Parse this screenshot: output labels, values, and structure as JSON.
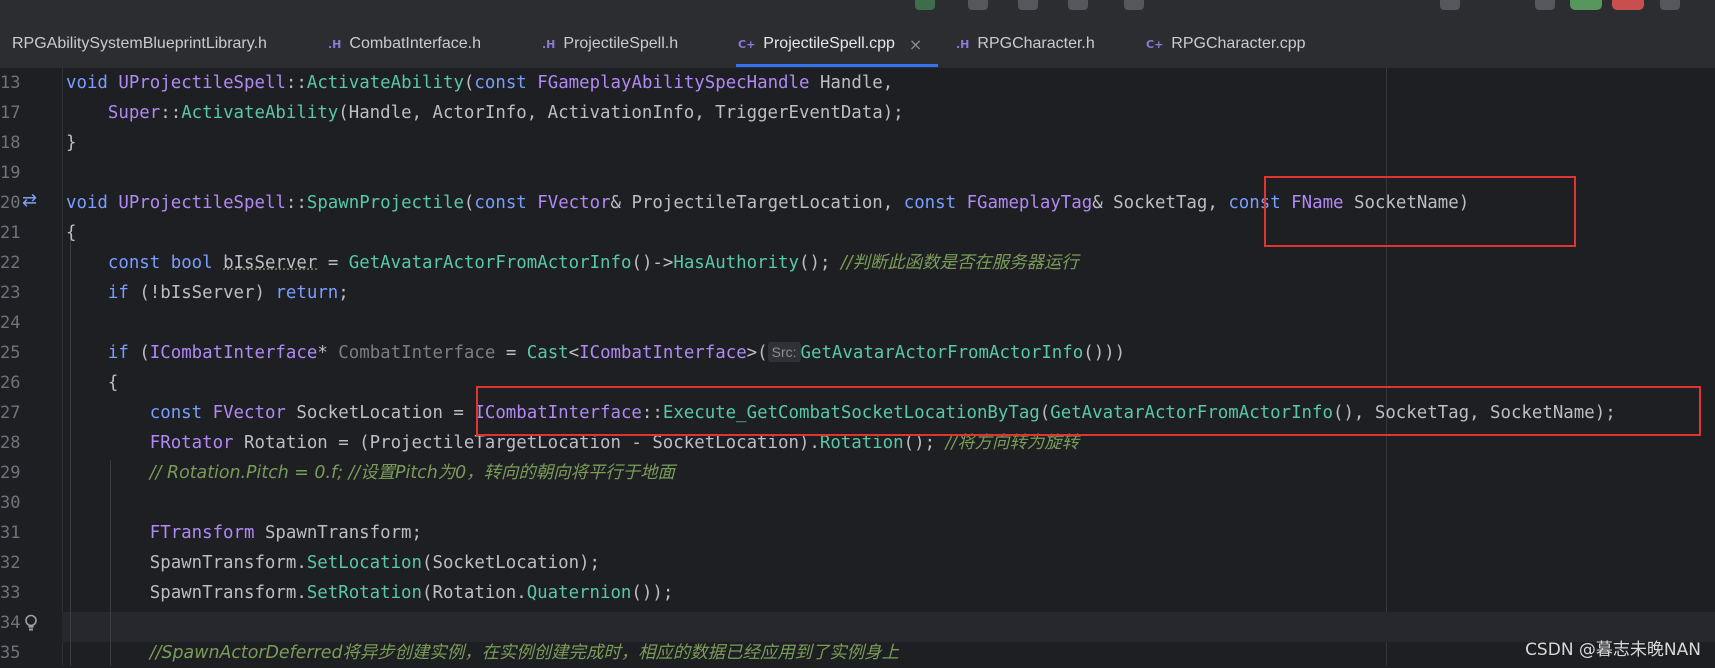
{
  "tabs": [
    {
      "label": "RPGAbilitySystemBlueprintLibrary.h",
      "ext": "",
      "active": false
    },
    {
      "label": "CombatInterface.h",
      "ext": ".H",
      "active": false
    },
    {
      "label": "ProjectileSpell.h",
      "ext": ".H",
      "active": false
    },
    {
      "label": "ProjectileSpell.cpp",
      "ext": "C+",
      "active": true,
      "close": "×"
    },
    {
      "label": "RPGCharacter.h",
      "ext": ".H",
      "active": false
    },
    {
      "label": "RPGCharacter.cpp",
      "ext": "C+",
      "active": false
    }
  ],
  "line_numbers": [
    "13",
    "17",
    "18",
    "19",
    "20",
    "21",
    "22",
    "23",
    "24",
    "25",
    "26",
    "27",
    "28",
    "29",
    "30",
    "31",
    "32",
    "33",
    "34",
    "35"
  ],
  "code": {
    "l13": {
      "void": "void",
      "cls": "UProjectileSpell",
      "sep": "::",
      "fn": "ActivateAbility",
      "open": "(",
      "const": "const",
      "type": "FGameplayAbilitySpecHandle",
      "rest": " Handle,"
    },
    "l17": {
      "super": "Super",
      "sep": "::",
      "fn": "ActivateAbility",
      "rest": "(Handle, ActorInfo, ActivationInfo, TriggerEventData);"
    },
    "l18": {
      "text": "}"
    },
    "l20": {
      "void": "void",
      "cls": "UProjectileSpell",
      "sep": "::",
      "fn": "SpawnProjectile",
      "open": "(",
      "const1": "const",
      "type1": "FVector",
      "mid1": "& ProjectileTargetLocation, ",
      "const2": "const",
      "type2": "FGameplayTag",
      "mid2": "& SocketTag, ",
      "const3": "const",
      "type3": "FName",
      "rest": " SocketName)"
    },
    "l21": {
      "text": "{"
    },
    "l22": {
      "const": "const",
      "bool": "bool",
      "var": "bIsServer",
      "eq": " = ",
      "fn1": "GetAvatarActorFromActorInfo",
      "arrow": "()->",
      "fn2": "HasAuthority",
      "end": "(); ",
      "comment": "//判断此函数是否在服务器运行"
    },
    "l23": {
      "if": "if",
      "mid": " (!bIsServer) ",
      "ret": "return",
      "end": ";"
    },
    "l25": {
      "if": "if",
      "open": " (",
      "iface": "ICombatInterface",
      "star": "* ",
      "gray": "CombatInterface",
      "eq": " = ",
      "cast": "Cast",
      "lt": "<",
      "iface2": "ICombatInterface",
      "gt": ">(",
      "hint": "Src:",
      "fn": "GetAvatarActorFromActorInfo",
      "end": "()))"
    },
    "l26": {
      "text": "{"
    },
    "l27": {
      "const": "const",
      "type": "FVector",
      "var": " SocketLocation = ",
      "iface": "ICombatInterface",
      "sep": "::",
      "fn": "Execute_GetCombatSocketLocationByTag",
      "open": "(",
      "fn2": "GetAvatarActorFromActorInfo",
      "rest": "(), SocketTag, SocketName);"
    },
    "l28": {
      "type": "FRotator",
      "mid": " Rotation = (ProjectileTargetLocation - SocketLocation).",
      "fn": "Rotation",
      "end": "(); ",
      "comment": "//将方向转为旋转"
    },
    "l29": {
      "comment": "// Rotation.Pitch = 0.f; //设置Pitch为0，转向的朝向将平行于地面"
    },
    "l31": {
      "type": "FTransform",
      "rest": " SpawnTransform;"
    },
    "l32": {
      "obj": "SpawnTransform.",
      "fn": "SetLocation",
      "rest": "(SocketLocation);"
    },
    "l33": {
      "obj": "SpawnTransform.",
      "fn": "SetRotation",
      "mid": "(Rotation.",
      "fn2": "Quaternion",
      "rest": "());"
    },
    "l35": {
      "comment": "//SpawnActorDeferred将异步创建实例，在实例创建完成时，相应的数据已经应用到了实例身上"
    }
  },
  "watermark": "CSDN @暮志未晚NAN",
  "colors": {
    "highlight_box": "#e0342f",
    "tab_underline": "#3574f0",
    "background": "#1e1f22"
  },
  "icons": [
    "override-arrow-icon",
    "lightbulb-icon"
  ]
}
